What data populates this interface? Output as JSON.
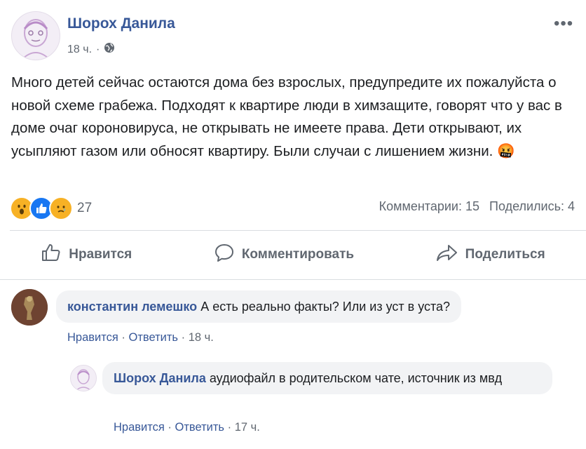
{
  "post": {
    "author": "Шорох Данила",
    "time": "18 ч.",
    "dot": "·",
    "text": "Много детей сейчас остаются дома без взрослых, предупредите их пожалуйста о новой схеме грабежа. Подходят к квартире люди в химзащите, говорят что у вас в доме очаг короновируса, не открывать не имеете права. Дети открывают, их усыпляют газом или обносят квартиру. Были случаи с лишением жизни.",
    "emoji": "🤬",
    "reaction_count": "27",
    "comments_count": "Комментарии: 15",
    "shares_count": "Поделились: 4",
    "more": "•••"
  },
  "actions": {
    "like": "Нравится",
    "comment": "Комментировать",
    "share": "Поделиться"
  },
  "comments": [
    {
      "author": "константин лемешко",
      "text": "А есть реально факты? Или из уст в уста?",
      "like": "Нравится",
      "reply": "Ответить",
      "time": "18 ч."
    },
    {
      "author": "Шорох Данила",
      "text": "аудиофайл в родительском чате, источник из мвд",
      "like": "Нравится",
      "reply": "Ответить",
      "time": "17 ч."
    }
  ],
  "sep": "·",
  "colors": {
    "link": "#385898",
    "muted": "#606770",
    "like_blue": "#1877f2",
    "bubble": "#f2f3f5"
  }
}
